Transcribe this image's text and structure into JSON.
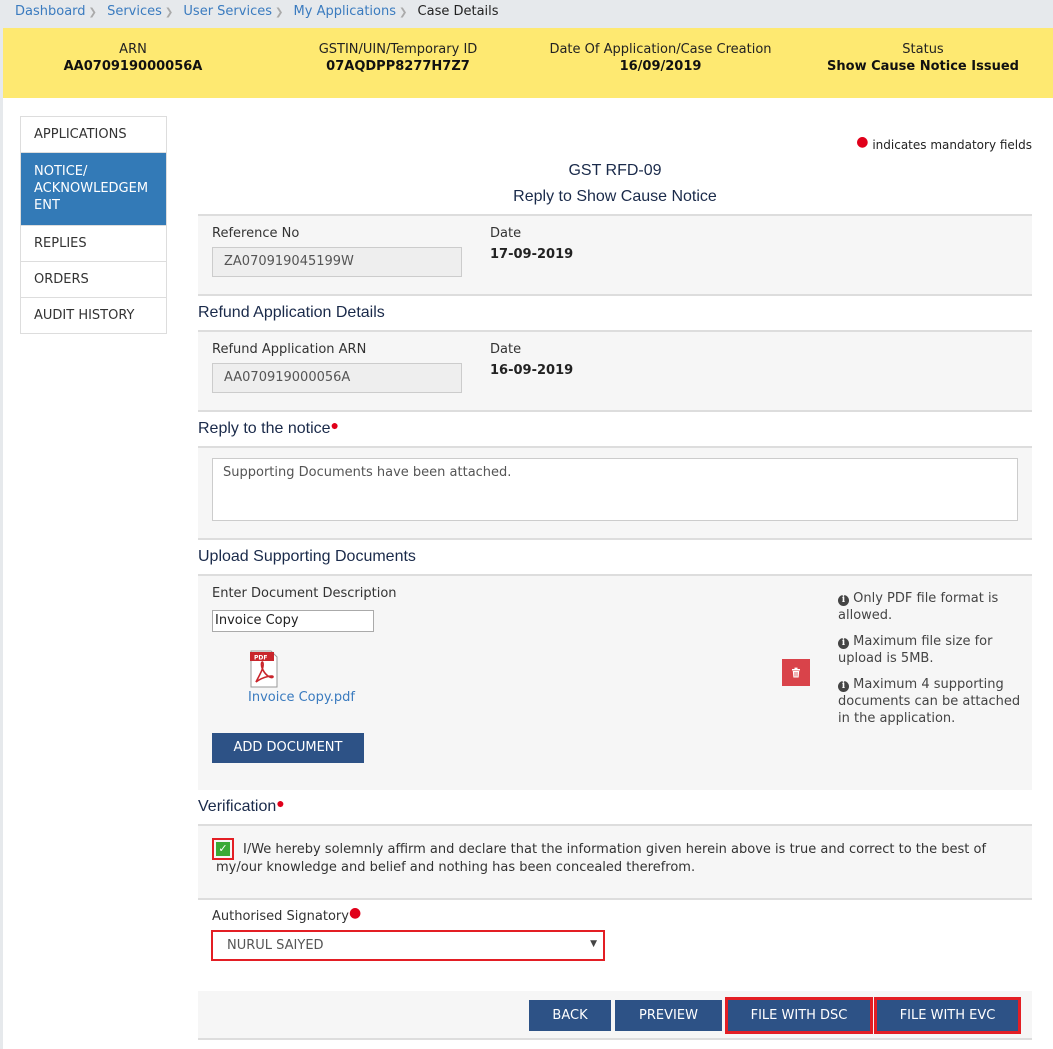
{
  "breadcrumb": {
    "items": [
      "Dashboard",
      "Services",
      "User Services",
      "My Applications"
    ],
    "current": "Case Details"
  },
  "case_header": {
    "arn_label": "ARN",
    "arn_value": "AA070919000056A",
    "gstin_label": "GSTIN/UIN/Temporary ID",
    "gstin_value": "07AQDPP8277H7Z7",
    "date_label": "Date Of Application/Case Creation",
    "date_value": "16/09/2019",
    "status_label": "Status",
    "status_value": "Show Cause Notice Issued"
  },
  "sidebar": {
    "items": [
      {
        "label": "APPLICATIONS",
        "active": false
      },
      {
        "label": "NOTICE/ ACKNOWLEDGEM ENT",
        "active": true
      },
      {
        "label": "REPLIES",
        "active": false
      },
      {
        "label": "ORDERS",
        "active": false
      },
      {
        "label": "AUDIT HISTORY",
        "active": false
      }
    ]
  },
  "mandatory_note": "indicates mandatory fields",
  "form": {
    "code": "GST RFD-09",
    "title": "Reply to Show Cause Notice",
    "reference": {
      "ref_label": "Reference No",
      "ref_value": "ZA070919045199W",
      "date_label": "Date",
      "date_value": "17-09-2019"
    },
    "refund_details": {
      "heading": "Refund Application Details",
      "arn_label": "Refund Application ARN",
      "arn_value": "AA070919000056A",
      "date_label": "Date",
      "date_value": "16-09-2019"
    },
    "reply": {
      "heading": "Reply to the notice",
      "value": "Supporting Documents have been attached."
    },
    "upload": {
      "heading": "Upload Supporting Documents",
      "desc_label": "Enter Document Description",
      "desc_value": "Invoice Copy",
      "file_name": "Invoice Copy.pdf",
      "add_button": "ADD DOCUMENT",
      "info": [
        "Only PDF file format is allowed.",
        "Maximum file size for upload is 5MB.",
        " Maximum 4 supporting documents can be attached in the application."
      ]
    },
    "verification": {
      "heading": "Verification",
      "checked": true,
      "text": "I/We hereby solemnly affirm and declare that the information given herein above is true and correct to the best of my/our knowledge and belief and nothing has been concealed therefrom.",
      "signatory_label": "Authorised Signatory",
      "signatory_value": "NURUL SAIYED"
    },
    "buttons": {
      "back": "BACK",
      "preview": "PREVIEW",
      "file_dsc": "FILE WITH DSC",
      "file_evc": "FILE WITH EVC"
    }
  },
  "colors": {
    "header_yellow": "#fee971",
    "sidebar_active": "#337ab7",
    "button_blue": "#2d5286",
    "highlight_red": "#e31e24",
    "delete_red": "#d9434a",
    "link_blue": "#3a7bbf"
  }
}
